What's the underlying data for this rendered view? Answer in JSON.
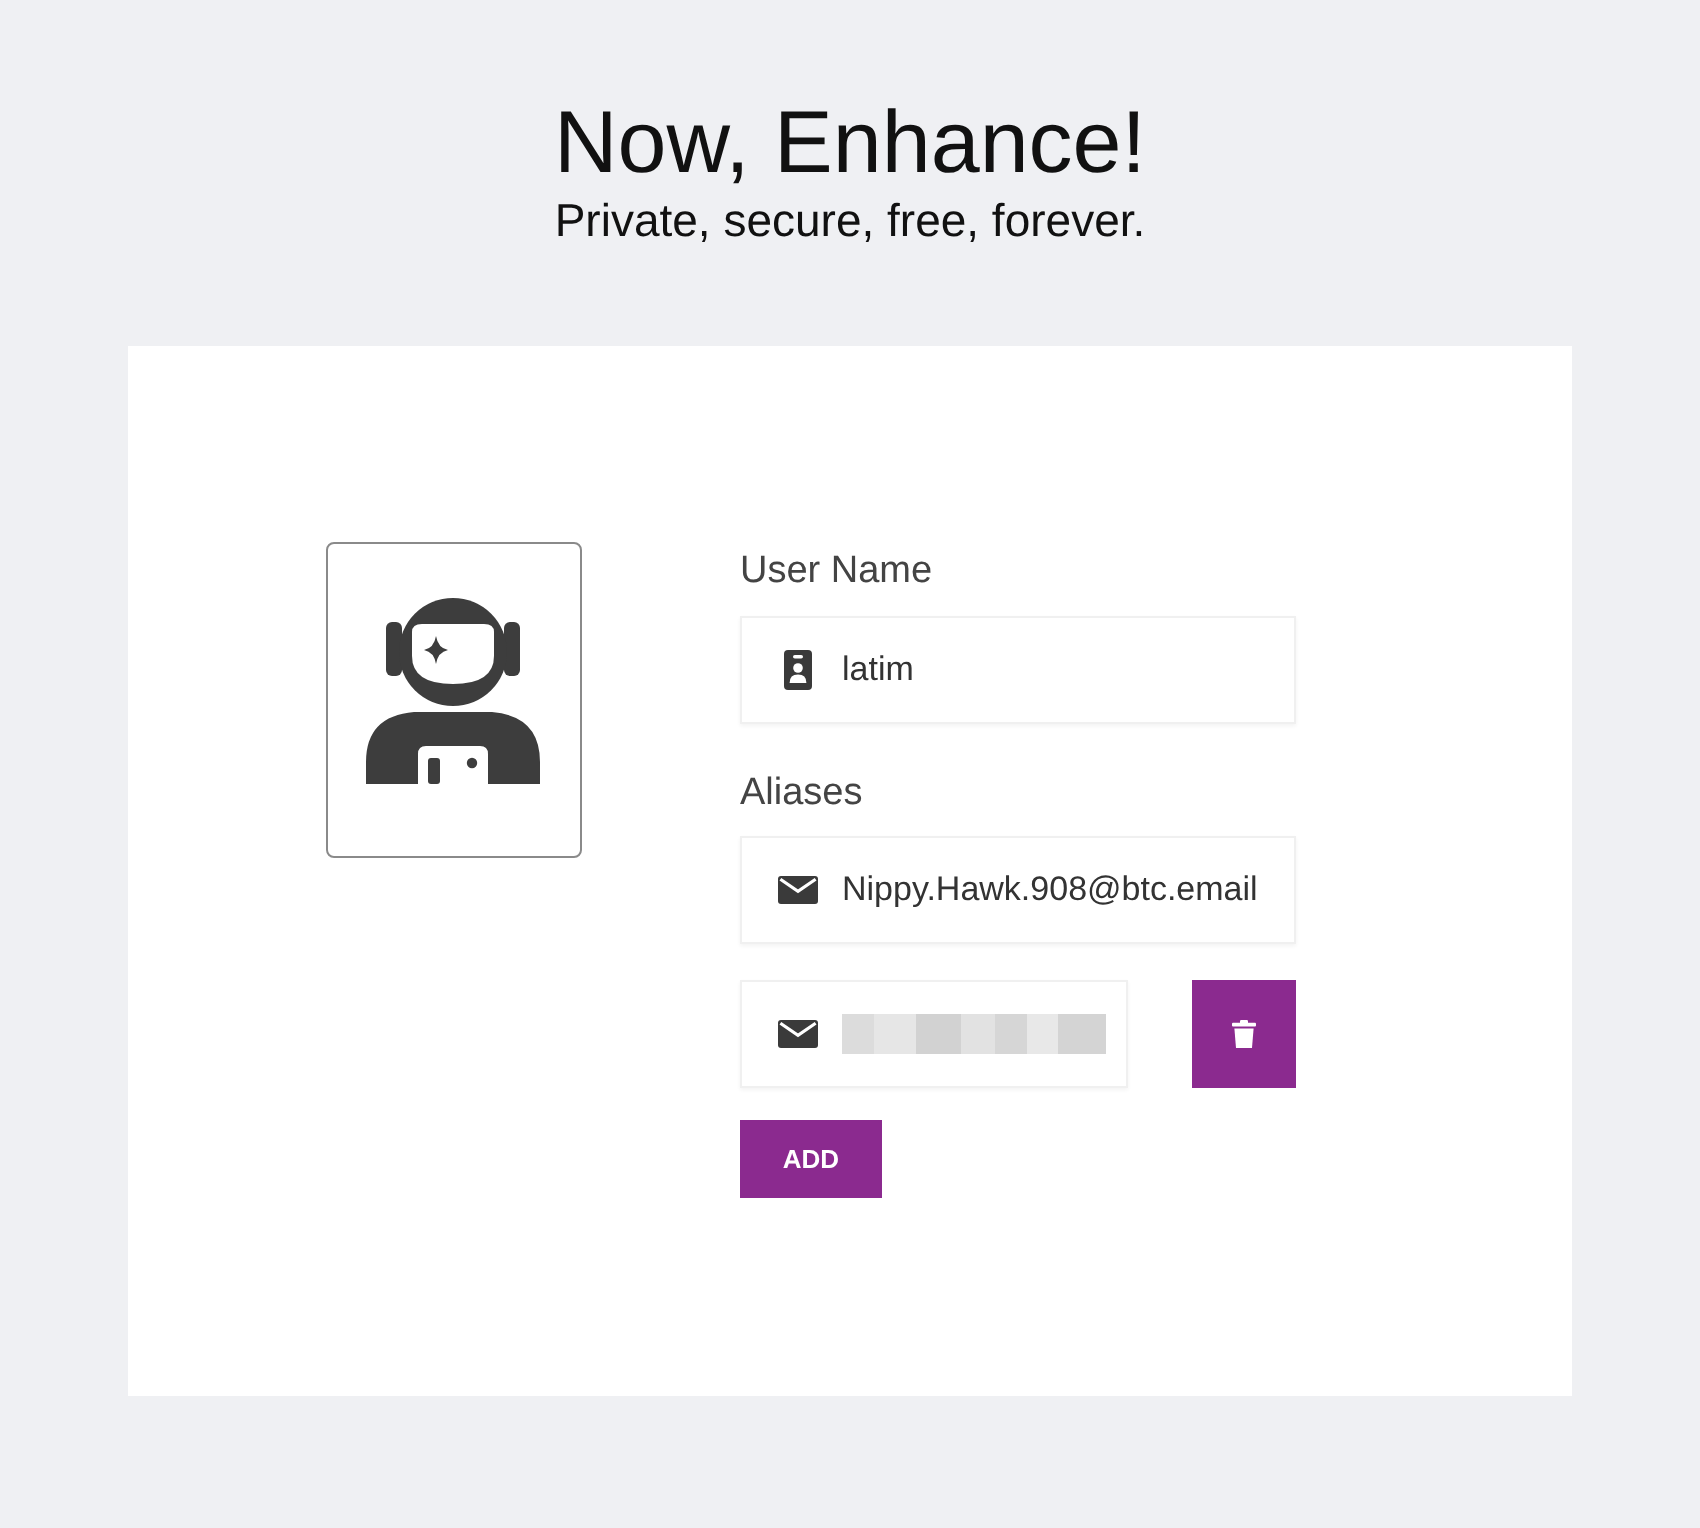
{
  "header": {
    "title": "Now, Enhance!",
    "subtitle": "Private, secure, free, forever."
  },
  "form": {
    "username": {
      "label": "User Name",
      "value": "latim"
    },
    "aliases": {
      "label": "Aliases",
      "items": [
        {
          "kind": "text",
          "value": "Nippy.Hawk.908@btc.email",
          "deletable": false
        },
        {
          "kind": "blurred",
          "deletable": true
        }
      ]
    },
    "add_button": "ADD"
  }
}
